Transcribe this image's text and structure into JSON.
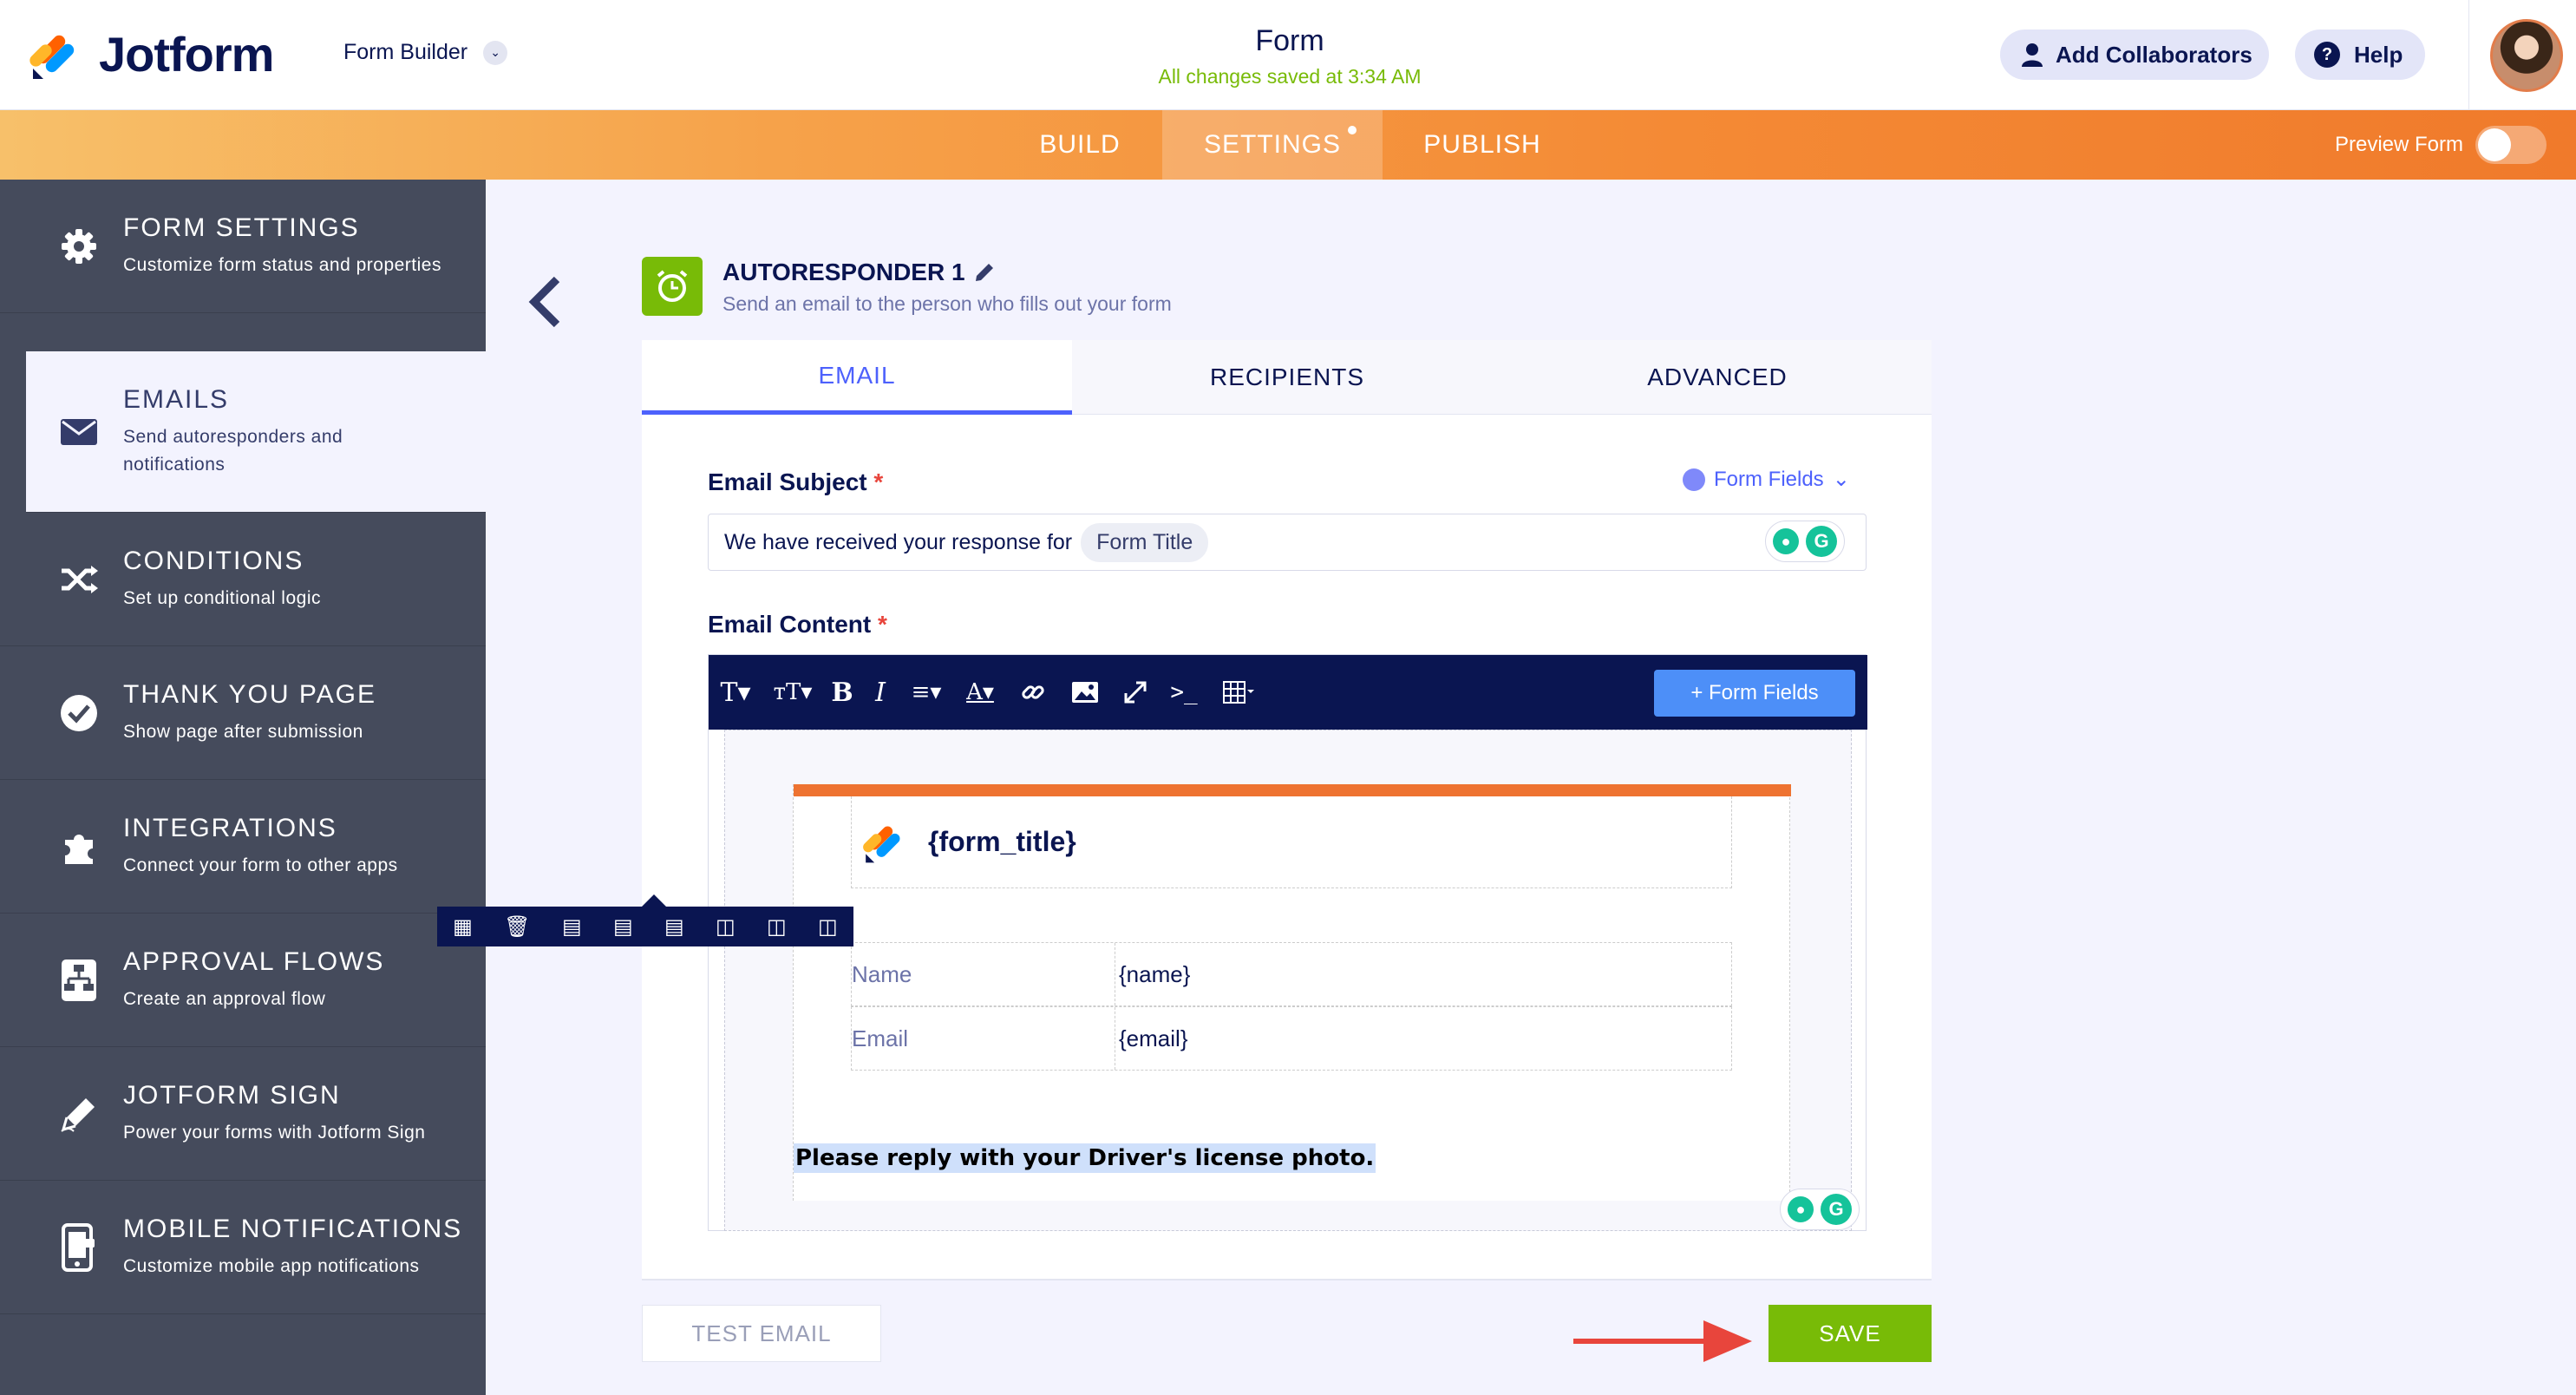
{
  "header": {
    "brand": "Jotform",
    "builder_select": "Form Builder",
    "form_title": "Form",
    "save_status": "All changes saved at 3:34 AM",
    "collaborators_label": "Add Collaborators",
    "help_label": "Help",
    "help_icon": "?"
  },
  "nav": {
    "tabs": [
      "BUILD",
      "SETTINGS",
      "PUBLISH"
    ],
    "active_tab": "SETTINGS",
    "preview_label": "Preview Form",
    "preview_on": false
  },
  "sidebar": {
    "items": [
      {
        "title": "FORM SETTINGS",
        "subtitle": "Customize form status and properties",
        "icon": "gear-icon"
      },
      {
        "title": "EMAILS",
        "subtitle": "Send autoresponders and notifications",
        "icon": "envelope-icon"
      },
      {
        "title": "CONDITIONS",
        "subtitle": "Set up conditional logic",
        "icon": "shuffle-icon"
      },
      {
        "title": "THANK YOU PAGE",
        "subtitle": "Show page after submission",
        "icon": "check-circle-icon"
      },
      {
        "title": "INTEGRATIONS",
        "subtitle": "Connect your form to other apps",
        "icon": "puzzle-icon"
      },
      {
        "title": "APPROVAL FLOWS",
        "subtitle": "Create an approval flow",
        "icon": "flow-icon"
      },
      {
        "title": "JOTFORM SIGN",
        "subtitle": "Power your forms with Jotform Sign",
        "icon": "pen-icon"
      },
      {
        "title": "MOBILE NOTIFICATIONS",
        "subtitle": "Customize mobile app notifications",
        "icon": "phone-icon"
      }
    ],
    "active_item": "EMAILS"
  },
  "autoresponder": {
    "title": "AUTORESPONDER 1",
    "subtitle": "Send an email to the person who fills out your form",
    "tabs": [
      "EMAIL",
      "RECIPIENTS",
      "ADVANCED"
    ],
    "active_tab": "EMAIL",
    "subject_label": "Email Subject",
    "content_label": "Email Content",
    "required_mark": "*",
    "form_fields_label": "Form Fields",
    "subject_text": "We have received your response for",
    "subject_chip": "Form Title",
    "grammarly_letter": "G",
    "toolbar_form_fields": "+ Form Fields",
    "email_body": {
      "title_placeholder": "{form_title}",
      "rows": [
        {
          "label": "Name",
          "value": "{name}"
        },
        {
          "label": "Email",
          "value": "{email}"
        }
      ],
      "note": "Please reply with your Driver's license photo."
    }
  },
  "actions": {
    "test_email": "TEST EMAIL",
    "save": "SAVE"
  },
  "colors": {
    "accent": "#4d61fc",
    "save_green": "#78bb07",
    "nav_orange": "#f48a35",
    "sidebar": "#454b5c",
    "arrow_red": "#e8453c"
  }
}
